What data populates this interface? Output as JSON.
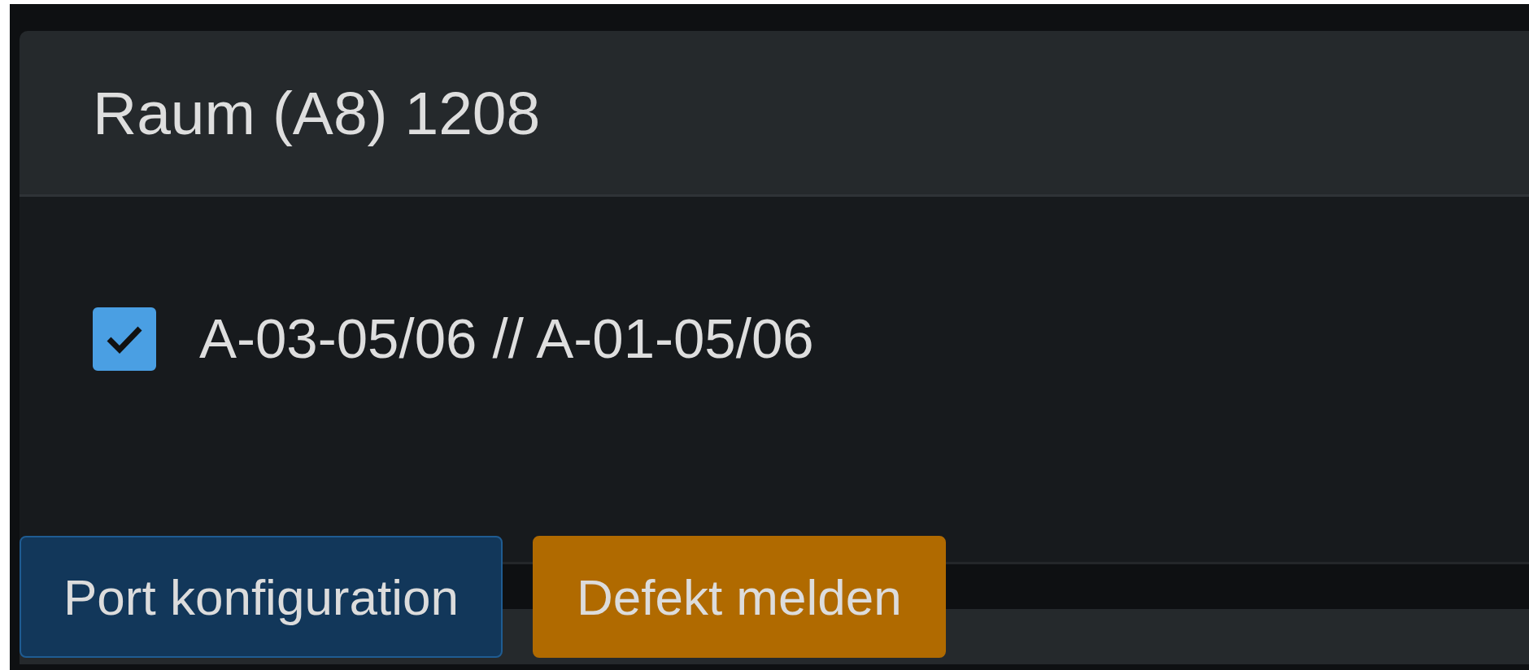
{
  "card": {
    "title": "Raum (A8) 1208",
    "ports": [
      {
        "label": "A-03-05/06 // A-01-05/06",
        "checked": true
      }
    ]
  },
  "buttons": [
    {
      "label": "Port konfiguration",
      "kind": "primary"
    },
    {
      "label": "Defekt melden",
      "kind": "warning"
    }
  ]
}
